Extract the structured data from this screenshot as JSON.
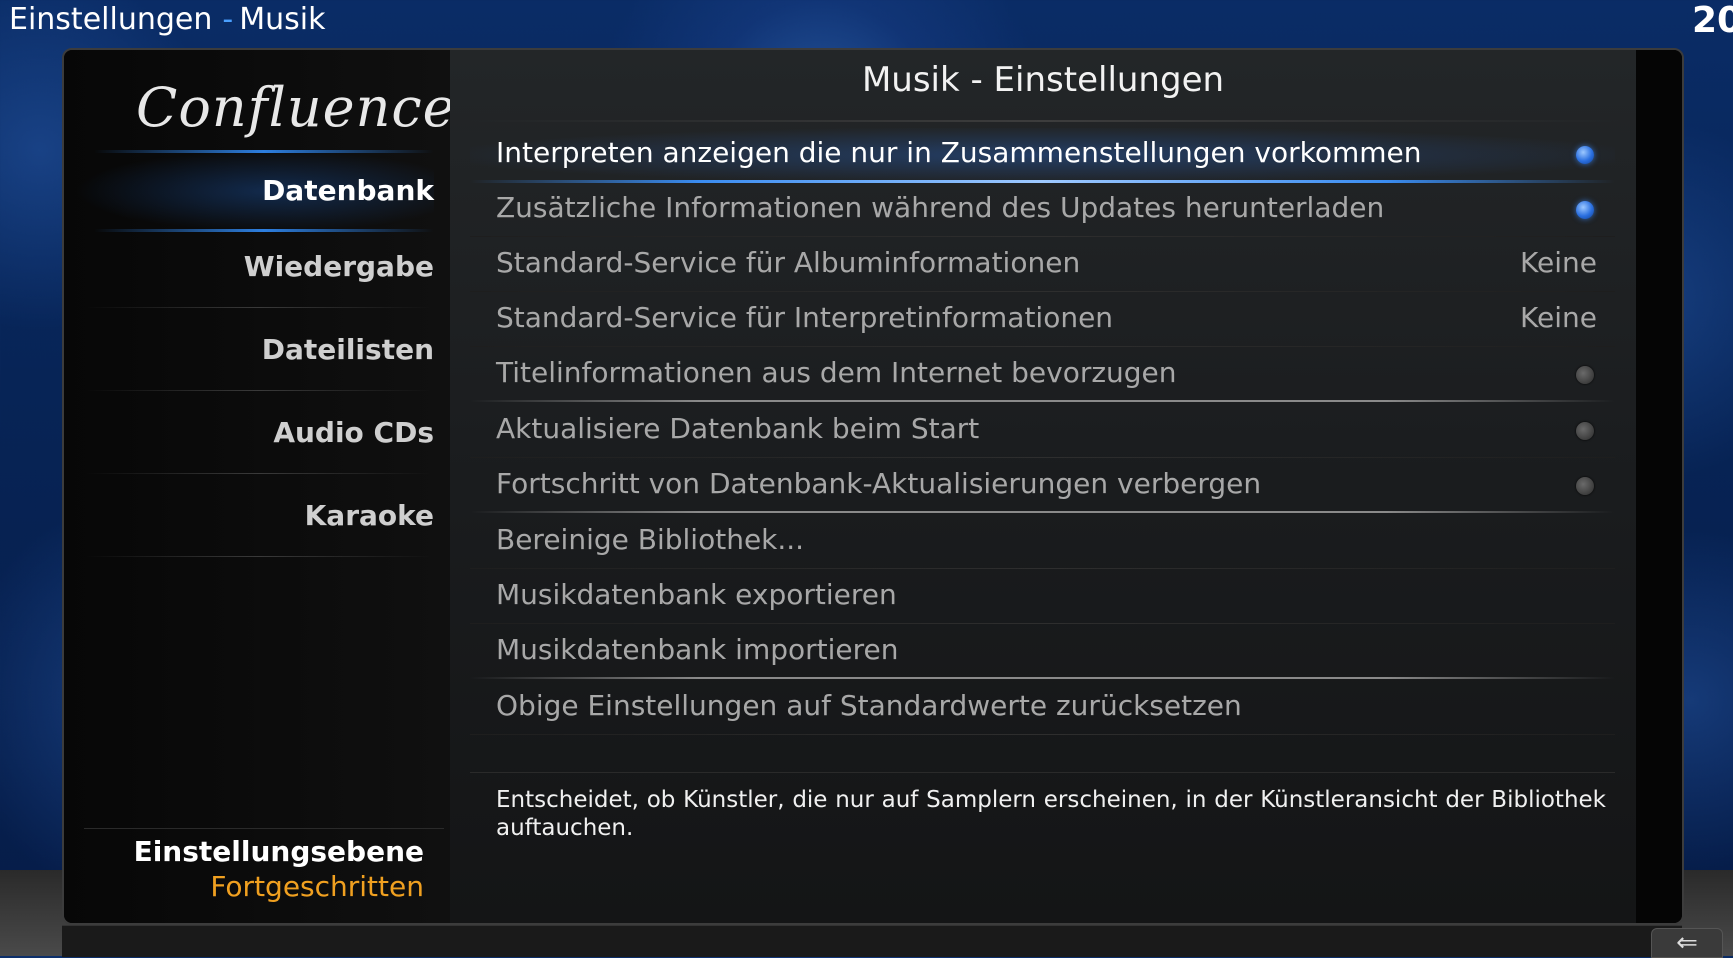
{
  "header": {
    "section": "Einstellungen",
    "separator": "-",
    "page": "Musik",
    "clock": "20"
  },
  "sidebar": {
    "logo": "Confluence",
    "items": [
      {
        "label": "Datenbank"
      },
      {
        "label": "Wiedergabe"
      },
      {
        "label": "Dateilisten"
      },
      {
        "label": "Audio CDs"
      },
      {
        "label": "Karaoke"
      }
    ],
    "level_label": "Einstellungsebene",
    "level_value": "Fortgeschritten"
  },
  "dialog": {
    "title": "Musik - Einstellungen",
    "close_label": "✕",
    "settings": [
      {
        "label": "Interpreten anzeigen die nur in Zusammenstellungen vorkommen",
        "type": "toggle",
        "value": "on"
      },
      {
        "label": "Zusätzliche Informationen während des Updates herunterladen",
        "type": "toggle",
        "value": "on"
      },
      {
        "label": "Standard-Service für Albuminformationen",
        "type": "value",
        "value": "Keine"
      },
      {
        "label": "Standard-Service für Interpretinformationen",
        "type": "value",
        "value": "Keine"
      },
      {
        "label": "Titelinformationen aus dem Internet bevorzugen",
        "type": "toggle",
        "value": "off"
      },
      {
        "label": "Aktualisiere Datenbank beim Start",
        "type": "toggle",
        "value": "off"
      },
      {
        "label": "Fortschritt von Datenbank-Aktualisierungen verbergen",
        "type": "toggle",
        "value": "off"
      },
      {
        "label": "Bereinige Bibliothek...",
        "type": "action"
      },
      {
        "label": "Musikdatenbank exportieren",
        "type": "action"
      },
      {
        "label": "Musikdatenbank importieren",
        "type": "action"
      },
      {
        "label": "Obige Einstellungen auf Standardwerte zurücksetzen",
        "type": "action"
      }
    ],
    "description": "Entscheidet, ob Künstler, die nur auf Samplern erscheinen, in der Künstleransicht der Bibliothek auftauchen."
  },
  "footer": {
    "back_icon": "back-arrow-icon",
    "back_glyph": "⇐"
  },
  "colors": {
    "accent": "#2d7fe0",
    "level": "#f0a020"
  }
}
